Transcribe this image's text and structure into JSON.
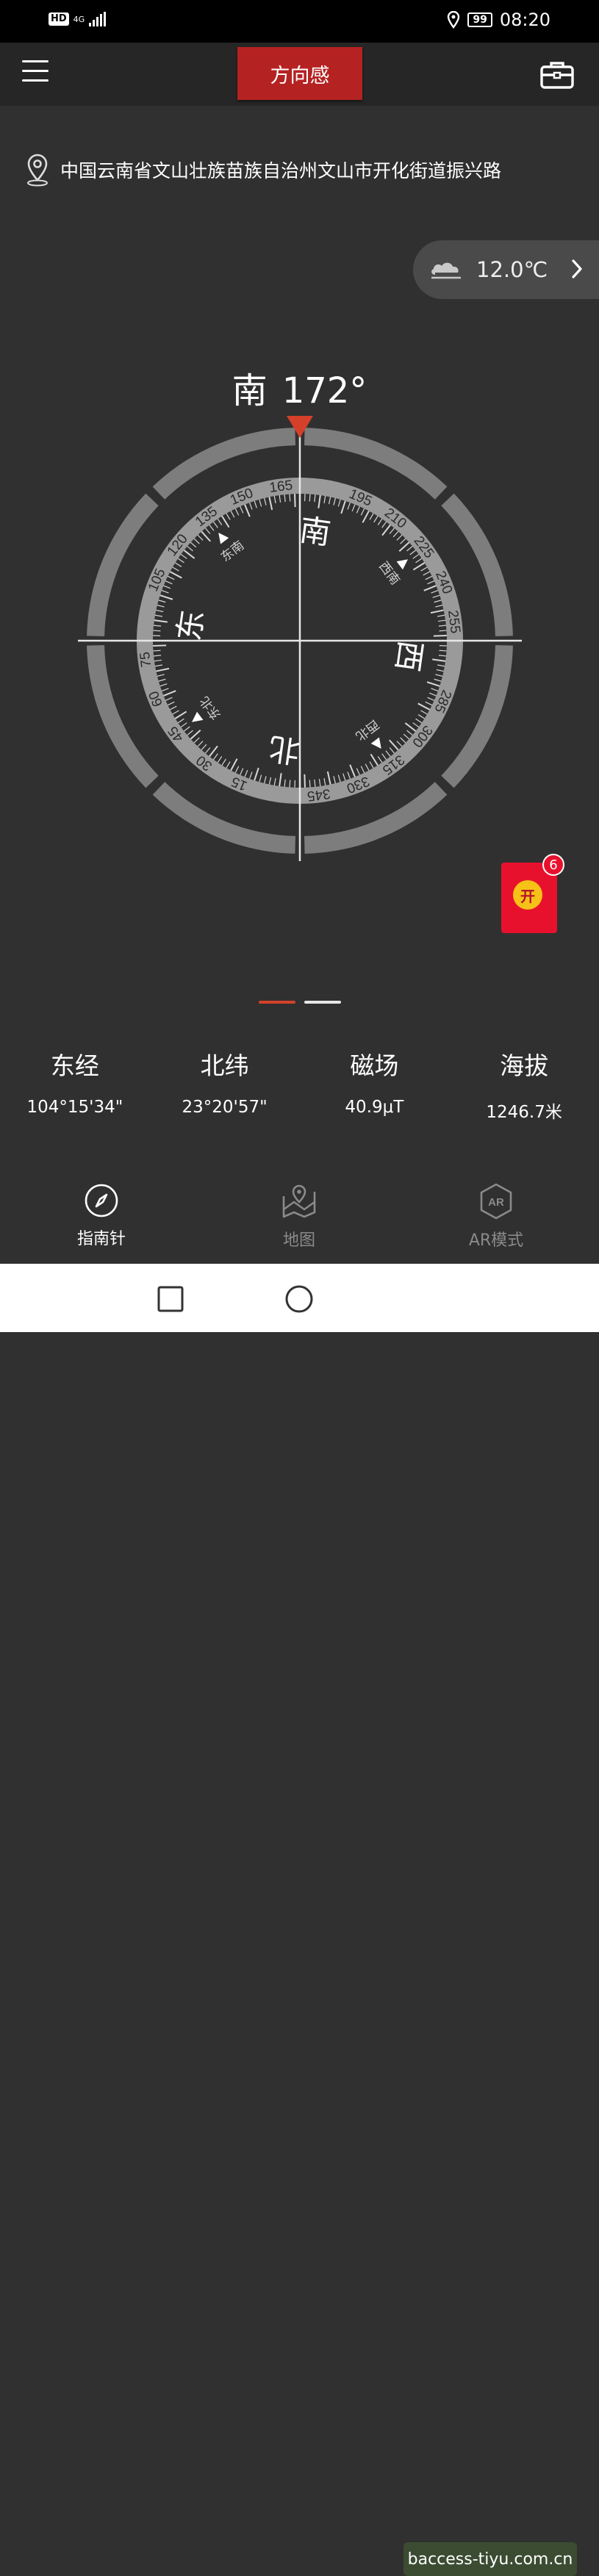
{
  "status_bar": {
    "hd": "HD",
    "network": "4G",
    "battery": "99",
    "time": "08:20"
  },
  "app_bar": {
    "title": "方向感"
  },
  "location": {
    "address": "中国云南省文山壮族苗族自治州文山市开化街道振兴路"
  },
  "weather": {
    "temperature": "12.0℃"
  },
  "heading": {
    "direction": "南",
    "degrees": "172°"
  },
  "compass": {
    "rotation_deg": 172,
    "tick_labels": [
      "15",
      "30",
      "45",
      "60",
      "75",
      "105",
      "120",
      "135",
      "150",
      "165",
      "195",
      "210",
      "225",
      "240",
      "255",
      "285",
      "300",
      "315",
      "330",
      "345"
    ],
    "cardinals": {
      "N": "北",
      "E": "东",
      "S": "南",
      "W": "西"
    },
    "intercardinals": {
      "NE": "东北",
      "SE": "东南",
      "SW": "西南",
      "NW": "西北"
    },
    "accent_color": "#d5402a"
  },
  "red_packet": {
    "label": "开",
    "badge": "6"
  },
  "stats": [
    {
      "label": "东经",
      "value": "104°15'34\""
    },
    {
      "label": "北纬",
      "value": "23°20'57\""
    },
    {
      "label": "磁场",
      "value": "40.9μT"
    },
    {
      "label": "海拔",
      "value": "1246.7米"
    }
  ],
  "bottom_nav": [
    {
      "label": "指南针",
      "icon": "compass-icon",
      "active": true
    },
    {
      "label": "地图",
      "icon": "map-icon",
      "active": false
    },
    {
      "label": "AR模式",
      "icon": "ar-icon",
      "active": false
    }
  ],
  "watermark": "baccess-tiyu.com.cn"
}
